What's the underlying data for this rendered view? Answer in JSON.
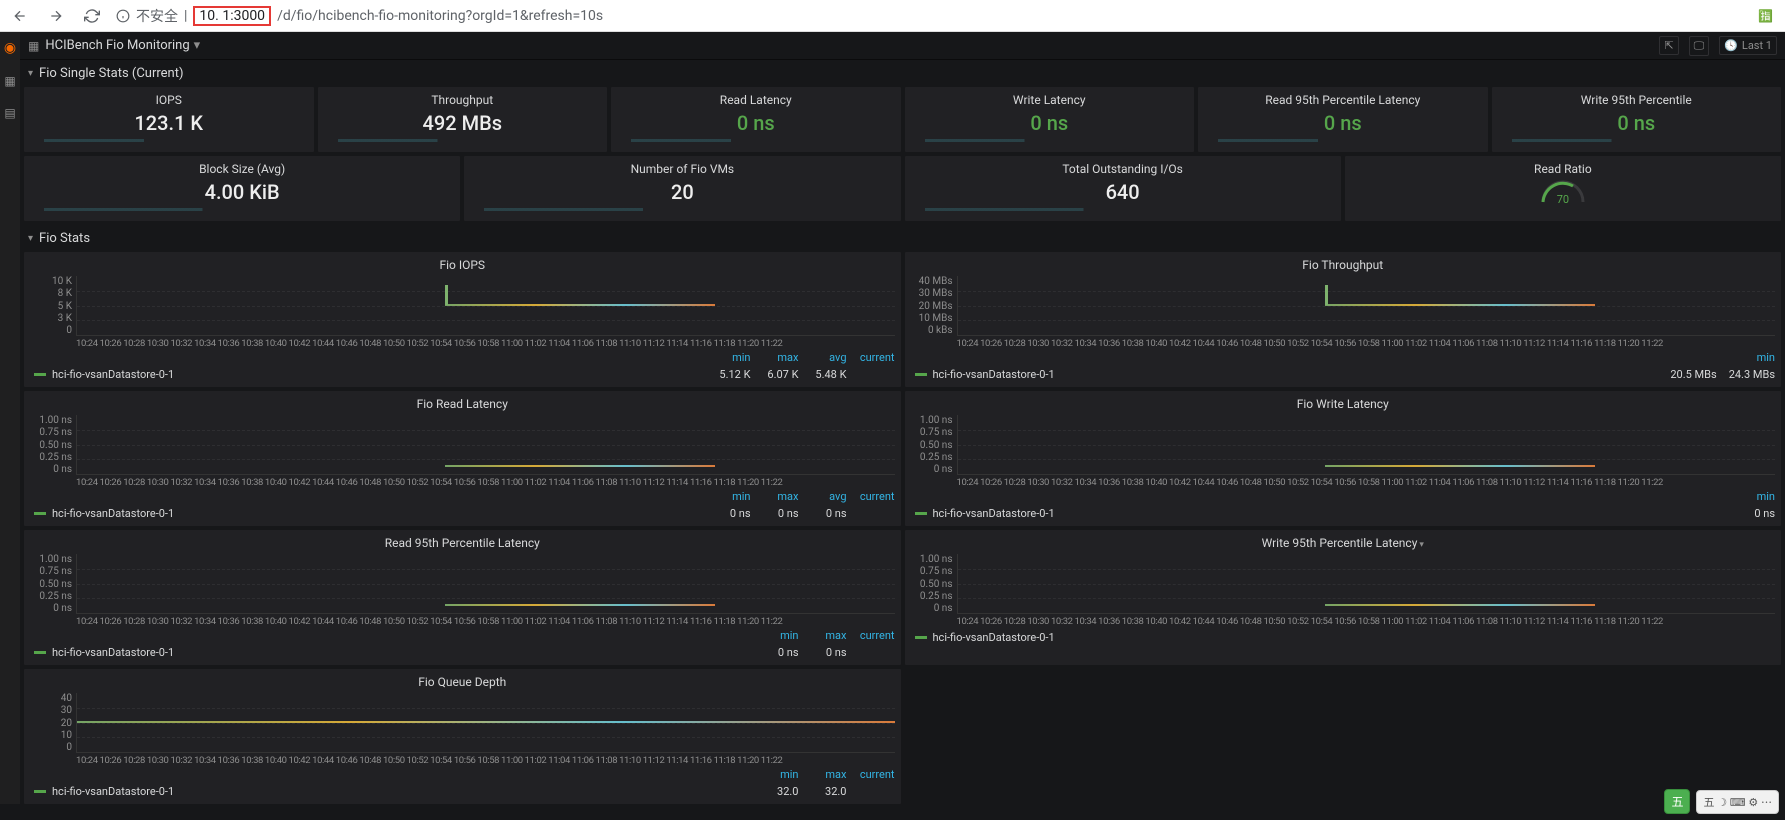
{
  "browser": {
    "insecure_label": "不安全",
    "url_host_redacted": "10.        1:3000",
    "url_path": "/d/fio/hcibench-fio-monitoring?orgId=1&refresh=10s"
  },
  "header": {
    "title": "HCIBench Fio Monitoring",
    "time_label": "Last 1"
  },
  "rows": {
    "single_stats": "Fio Single Stats (Current)",
    "fio_stats": "Fio Stats"
  },
  "stats_row1": [
    {
      "title": "IOPS",
      "value": "123.1 K",
      "cls": "white"
    },
    {
      "title": "Throughput",
      "value": "492 MBs",
      "cls": "white"
    },
    {
      "title": "Read Latency",
      "value": "0 ns",
      "cls": "green"
    },
    {
      "title": "Write Latency",
      "value": "0 ns",
      "cls": "green"
    },
    {
      "title": "Read 95th Percentile Latency",
      "value": "0 ns",
      "cls": "green"
    },
    {
      "title": "Write 95th Percentile",
      "value": "0 ns",
      "cls": "green"
    }
  ],
  "stats_row2": [
    {
      "title": "Block Size (Avg)",
      "value": "4.00 KiB",
      "cls": "white"
    },
    {
      "title": "Number of Fio VMs",
      "value": "20",
      "cls": "white"
    },
    {
      "title": "Total Outstanding I/Os",
      "value": "640",
      "cls": "white"
    },
    {
      "title": "Read Ratio",
      "value": "70",
      "cls": "gauge"
    }
  ],
  "xaxis_ticks": "10:24 10:26 10:28  10:30 10:32 10:34 10:36 10:38  10:40 10:42 10:44 10:46 10:48  10:50 10:52 10:54 10:56 10:58  11:00 11:02 11:04 11:06 11:08  11:10 11:12 11:14 11:16 11:18 11:20 11:22",
  "series_name": "hci-fio-vsanDatastore-0-1",
  "legend_headers": {
    "min": "min",
    "max": "max",
    "avg": "avg",
    "current": "current"
  },
  "panels": {
    "iops": {
      "title": "Fio IOPS",
      "yticks": [
        "10 K",
        "8 K",
        "5 K",
        "3 K",
        "0"
      ],
      "cols": [
        "min",
        "max",
        "avg",
        "current"
      ],
      "vals": [
        "5.12 K",
        "6.07 K",
        "5.48 K",
        ""
      ]
    },
    "throughput": {
      "title": "Fio Throughput",
      "yticks": [
        "40 MBs",
        "30 MBs",
        "20 MBs",
        "10 MBs",
        "0 kBs"
      ],
      "cols": [
        "min"
      ],
      "vals": [
        "20.5 MBs",
        "24.3 MBs"
      ]
    },
    "read_lat": {
      "title": "Fio Read Latency",
      "yticks": [
        "1.00 ns",
        "0.75 ns",
        "0.50 ns",
        "0.25 ns",
        "0 ns"
      ],
      "cols": [
        "min",
        "max",
        "avg",
        "current"
      ],
      "vals": [
        "0 ns",
        "0 ns",
        "0 ns",
        ""
      ]
    },
    "write_lat": {
      "title": "Fio Write Latency",
      "yticks": [
        "1.00 ns",
        "0.75 ns",
        "0.50 ns",
        "0.25 ns",
        "0 ns"
      ],
      "cols": [
        "min"
      ],
      "vals": [
        "0 ns"
      ]
    },
    "read_95": {
      "title": "Read 95th Percentile Latency",
      "yticks": [
        "1.00 ns",
        "0.75 ns",
        "0.50 ns",
        "0.25 ns",
        "0 ns"
      ],
      "cols": [
        "min",
        "max",
        "current"
      ],
      "vals": [
        "0 ns",
        "0 ns",
        ""
      ]
    },
    "write_95": {
      "title": "Write 95th Percentile Latency",
      "yticks": [
        "1.00 ns",
        "0.75 ns",
        "0.50 ns",
        "0.25 ns",
        "0 ns"
      ],
      "cols": [],
      "vals": []
    },
    "queue": {
      "title": "Fio Queue Depth",
      "yticks": [
        "40",
        "30",
        "20",
        "10",
        "0"
      ],
      "cols": [
        "min",
        "max",
        "current"
      ],
      "vals": [
        "32.0",
        "32.0",
        ""
      ]
    }
  },
  "taskbar": {
    "ime": "五",
    "tray": "五 ☽ ⌨ ⚙ ⋯"
  },
  "chart_data": [
    {
      "type": "line",
      "title": "Fio IOPS",
      "ylabel": "IOPS",
      "ylim": [
        0,
        10000
      ],
      "x_range": [
        "10:24",
        "11:22"
      ],
      "series": [
        {
          "name": "hci-fio-vsanDatastore-0-1",
          "min": 5120,
          "max": 6070,
          "avg": 5480
        }
      ]
    },
    {
      "type": "line",
      "title": "Fio Throughput",
      "ylabel": "MBs",
      "ylim": [
        0,
        40
      ],
      "x_range": [
        "10:24",
        "11:22"
      ],
      "series": [
        {
          "name": "hci-fio-vsanDatastore-0-1",
          "min": 20.5,
          "approx_value": 24.3
        }
      ]
    },
    {
      "type": "line",
      "title": "Fio Read Latency",
      "ylabel": "ns",
      "ylim": [
        0,
        1
      ],
      "x_range": [
        "10:24",
        "11:22"
      ],
      "series": [
        {
          "name": "hci-fio-vsanDatastore-0-1",
          "min": 0,
          "max": 0,
          "avg": 0
        }
      ]
    },
    {
      "type": "line",
      "title": "Fio Write Latency",
      "ylabel": "ns",
      "ylim": [
        0,
        1
      ],
      "x_range": [
        "10:24",
        "11:22"
      ],
      "series": [
        {
          "name": "hci-fio-vsanDatastore-0-1",
          "min": 0
        }
      ]
    },
    {
      "type": "line",
      "title": "Read 95th Percentile Latency",
      "ylabel": "ns",
      "ylim": [
        0,
        1
      ],
      "x_range": [
        "10:24",
        "11:22"
      ],
      "series": [
        {
          "name": "hci-fio-vsanDatastore-0-1",
          "min": 0,
          "max": 0
        }
      ]
    },
    {
      "type": "line",
      "title": "Write 95th Percentile Latency",
      "ylabel": "ns",
      "ylim": [
        0,
        1
      ],
      "x_range": [
        "10:24",
        "11:22"
      ],
      "series": [
        {
          "name": "hci-fio-vsanDatastore-0-1"
        }
      ]
    },
    {
      "type": "line",
      "title": "Fio Queue Depth",
      "ylabel": "",
      "ylim": [
        0,
        40
      ],
      "x_range": [
        "10:24",
        "11:22"
      ],
      "series": [
        {
          "name": "hci-fio-vsanDatastore-0-1",
          "min": 32.0,
          "max": 32.0
        }
      ]
    }
  ]
}
